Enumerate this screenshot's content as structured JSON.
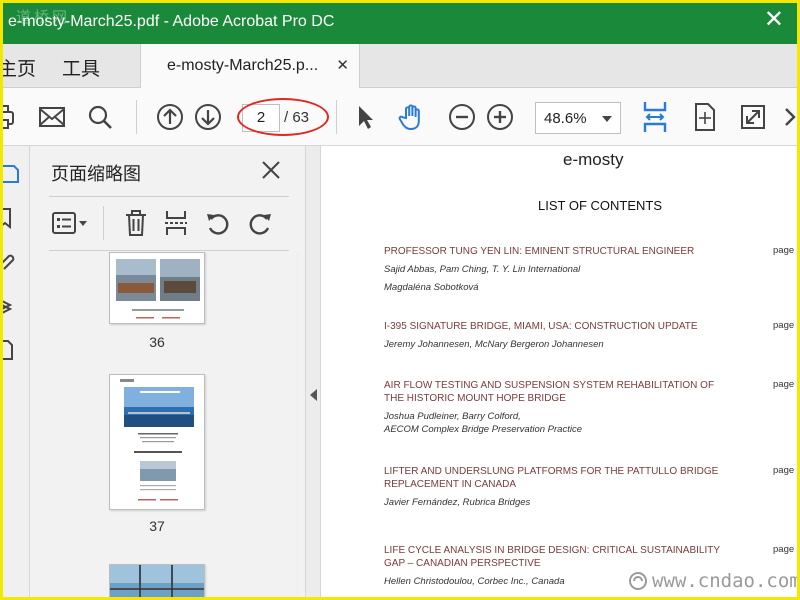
{
  "window": {
    "title": "e-mosty-March25.pdf - Adobe Acrobat Pro DC",
    "close_glyph": "✕"
  },
  "watermarks": {
    "top": "道桥网",
    "bottom": "www.cndao.com"
  },
  "menu": {
    "home": "主页",
    "tools": "工具"
  },
  "tab": {
    "label": "e-mosty-March25.p...",
    "close_glyph": "✕"
  },
  "toolbar": {
    "page_current": "2",
    "page_total": "/ 63",
    "zoom": "48.6%",
    "icons": [
      "print-icon",
      "mail-icon",
      "search-icon",
      "prev-page-icon",
      "next-page-icon",
      "select-cursor-icon",
      "hand-tool-icon",
      "zoom-out-icon",
      "zoom-in-icon",
      "fit-width-icon",
      "page-fit-icon",
      "fullscreen-icon",
      "more-icon"
    ],
    "accent": "#2a7ad9",
    "highlight_color": "#e0281e"
  },
  "left_panel": {
    "title": "页面缩略图",
    "close_glyph": "✕",
    "thumbnails": [
      {
        "page_label": "36"
      },
      {
        "page_label": "37"
      }
    ]
  },
  "document": {
    "brand": "e-mosty",
    "heading": "LIST OF CONTENTS",
    "entries": [
      {
        "title": "PROFESSOR TUNG YEN LIN: EMINENT STRUCTURAL ENGINEER",
        "authors": [
          "Sajid Abbas, Pam Ching, T. Y. Lin International",
          "Magdaléna Sobotková"
        ],
        "page": "page"
      },
      {
        "title": "I-395 SIGNATURE BRIDGE, MIAMI, USA: CONSTRUCTION UPDATE",
        "authors": [
          "Jeremy Johannesen, McNary Bergeron Johannesen"
        ],
        "page": "page"
      },
      {
        "title": "AIR FLOW TESTING AND SUSPENSION SYSTEM REHABILITATION OF THE HISTORIC MOUNT HOPE BRIDGE",
        "authors": [
          "Joshua Pudleiner, Barry Colford,",
          "AECOM Complex Bridge Preservation Practice"
        ],
        "page": "page"
      },
      {
        "title": "LIFTER AND UNDERSLUNG PLATFORMS FOR THE PATTULLO BRIDGE REPLACEMENT IN CANADA",
        "authors": [
          "Javier Fernández, Rubrica Bridges"
        ],
        "page": "page"
      },
      {
        "title": "LIFE CYCLE ANALYSIS IN BRIDGE DESIGN: CRITICAL SUSTAINABILITY GAP – CANADIAN PERSPECTIVE",
        "authors": [
          "Hellen Christodoulou, Corbec Inc., Canada"
        ],
        "page": "page"
      }
    ]
  }
}
